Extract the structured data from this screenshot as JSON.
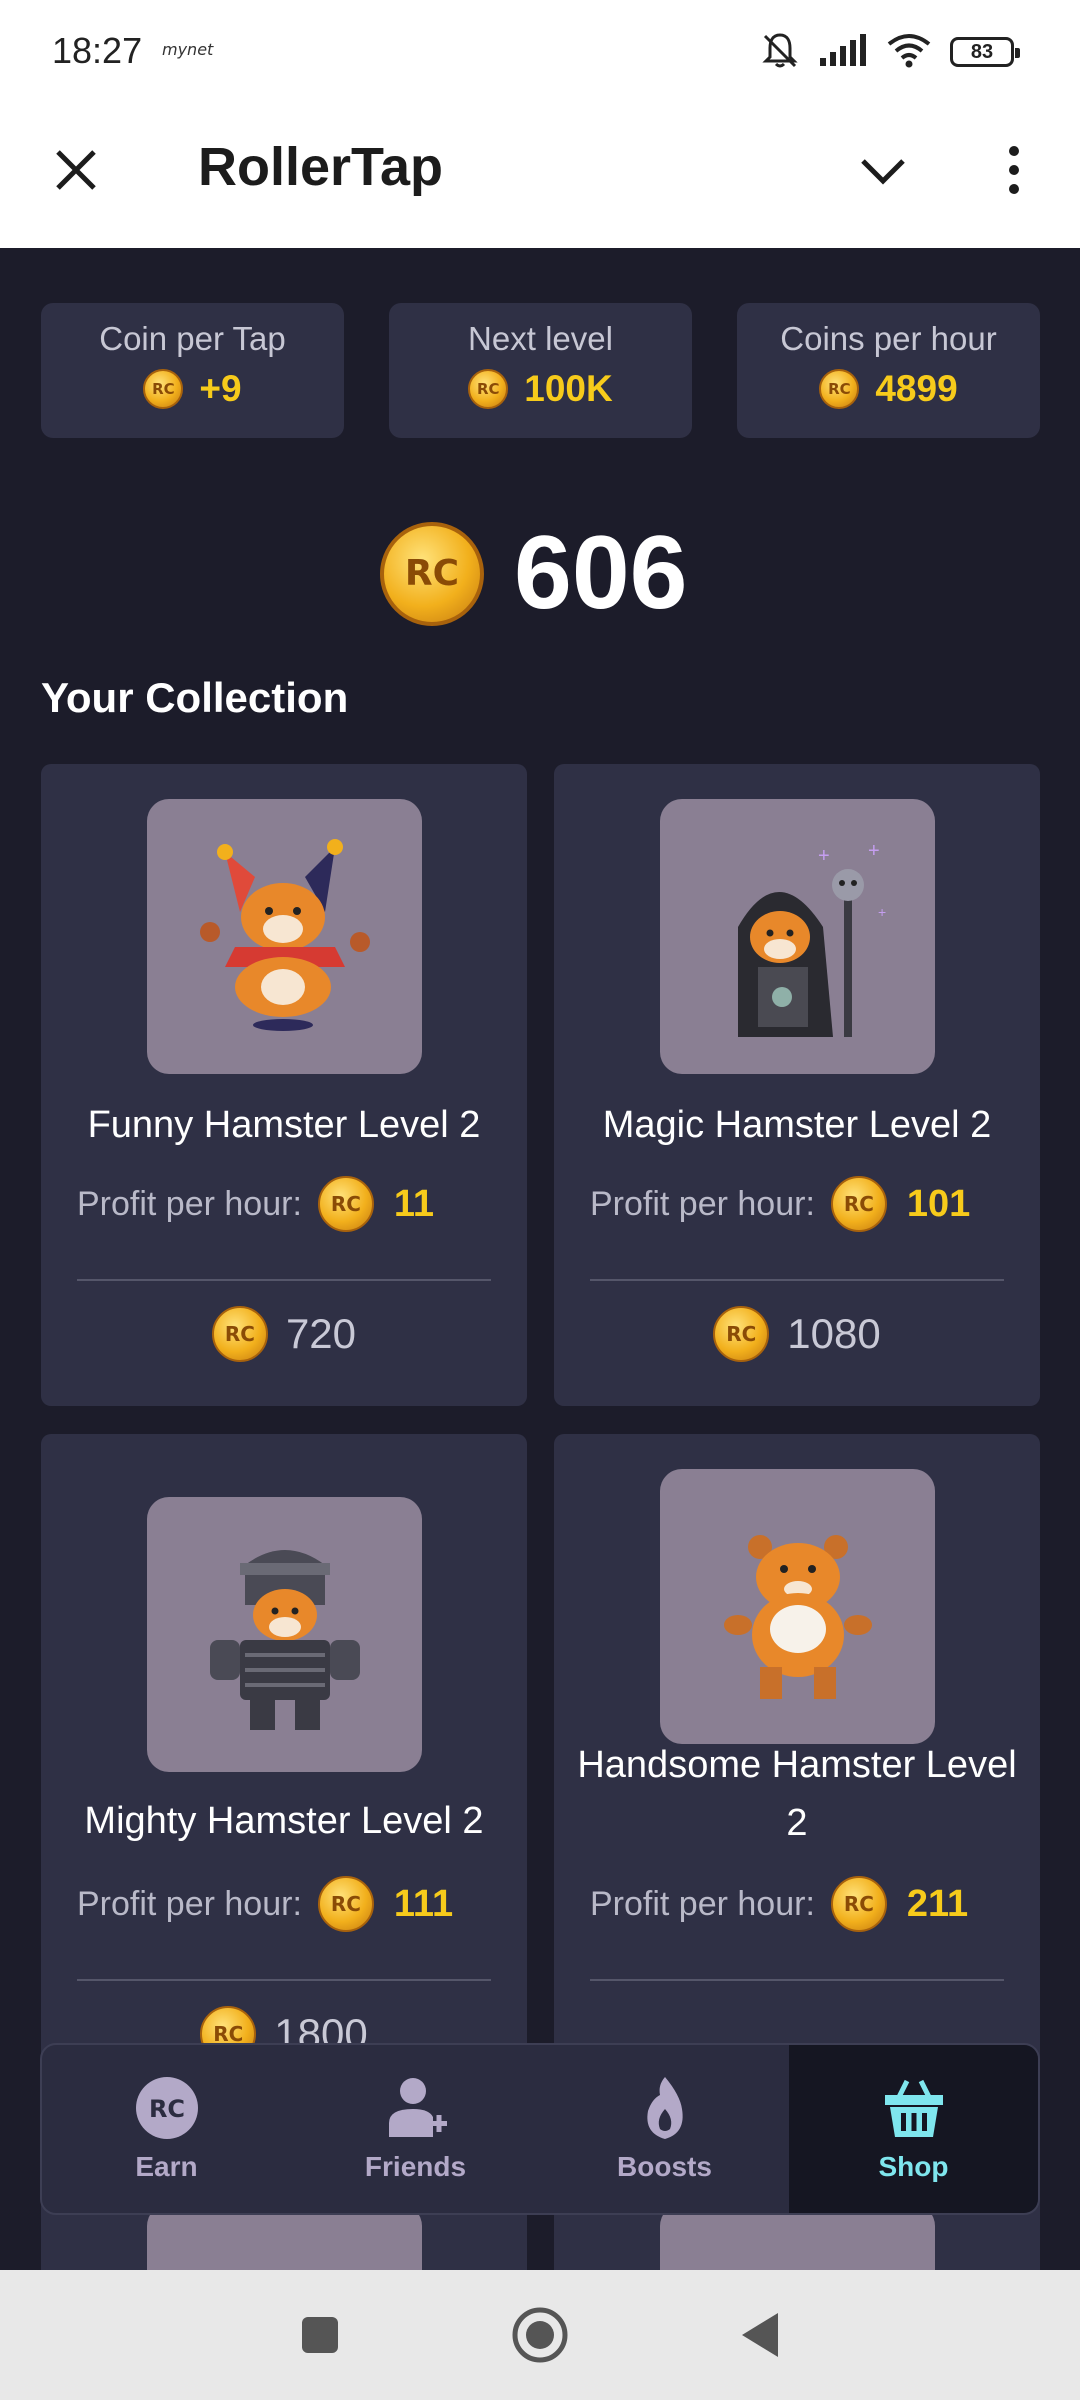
{
  "status_bar": {
    "time": "18:27",
    "brand": "mynet",
    "battery": "83"
  },
  "header": {
    "title": "RollerTap"
  },
  "stats": [
    {
      "label": "Coin per Tap",
      "value": "+9"
    },
    {
      "label": "Next level",
      "value": "100K"
    },
    {
      "label": "Coins per hour",
      "value": "4899"
    }
  ],
  "balance": "606",
  "coin_mark": "RC",
  "section_title": "Your Collection",
  "profit_label": "Profit per hour:",
  "cards": [
    {
      "name": "Funny Hamster Level 2",
      "profit": "11",
      "price": "720"
    },
    {
      "name": "Magic Hamster Level 2",
      "profit": "101",
      "price": "1080"
    },
    {
      "name": "Mighty Hamster Level 2",
      "profit": "111",
      "price": "1800"
    },
    {
      "name": "Handsome Hamster Level 2",
      "profit": "211",
      "price": ""
    }
  ],
  "nav": [
    {
      "label": "Earn",
      "icon": "rc-coin-icon"
    },
    {
      "label": "Friends",
      "icon": "add-friend-icon"
    },
    {
      "label": "Boosts",
      "icon": "flame-icon"
    },
    {
      "label": "Shop",
      "icon": "basket-icon",
      "active": true
    }
  ],
  "colors": {
    "background": "#1c1c2a",
    "card": "#2f3045",
    "accent_yellow": "#f7cb1b",
    "active_nav": "#7fe6ee"
  }
}
